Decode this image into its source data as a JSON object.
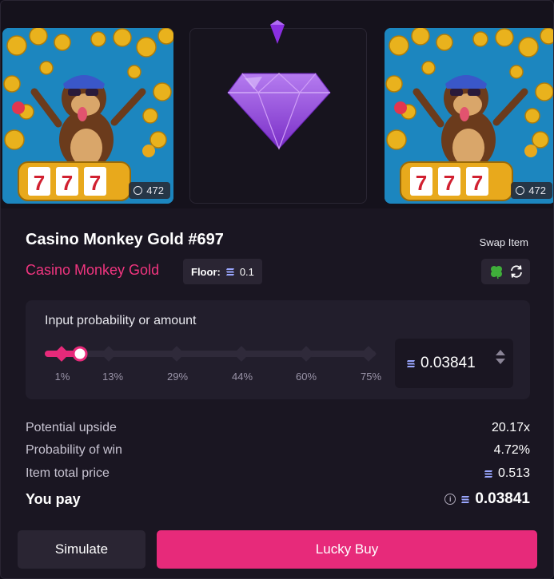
{
  "reel": {
    "left_card": {
      "count": "472"
    },
    "right_card": {
      "count": "472"
    }
  },
  "item": {
    "title": "Casino Monkey Gold #697",
    "collection": "Casino Monkey Gold",
    "floor_label": "Floor:",
    "floor_value": "0.1"
  },
  "swap": {
    "label": "Swap Item",
    "clover_icon": "clover-icon",
    "refresh_icon": "refresh-icon"
  },
  "probability": {
    "label": "Input probability or amount",
    "ticks": [
      "1%",
      "13%",
      "29%",
      "44%",
      "60%",
      "75%"
    ],
    "slider_value_percent": 4.72,
    "amount": "0.03841"
  },
  "stats": {
    "upside_label": "Potential upside",
    "upside_value": "20.17x",
    "win_label": "Probability of win",
    "win_value": "4.72%",
    "total_label": "Item total price",
    "total_value": "0.513",
    "pay_label": "You pay",
    "pay_value": "0.03841"
  },
  "buttons": {
    "simulate": "Simulate",
    "lucky_buy": "Lucky Buy"
  },
  "colors": {
    "accent": "#e72a7a",
    "collection": "#f0357f",
    "gem": "#9b4de0"
  }
}
